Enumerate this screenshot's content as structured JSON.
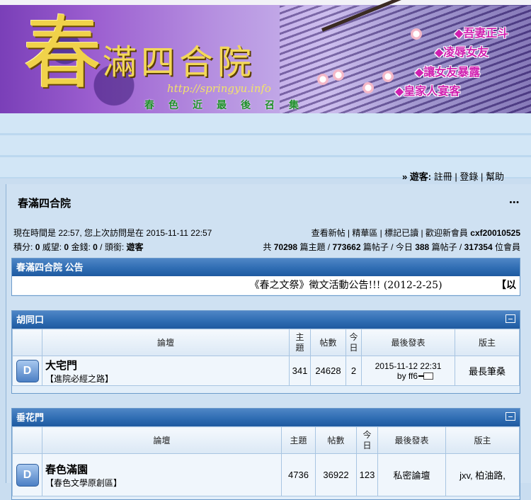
{
  "banner": {
    "title_first": "春",
    "title_rest": "滿四合院",
    "url": "http://springyu.info",
    "slogan": "春色近最後召集",
    "links": [
      "◆吾妻正斗",
      "◆凌辱女友",
      "◆讓女友暴露",
      "◆皇家人宴客"
    ]
  },
  "nav": {
    "guest_label": "» 遊客:",
    "register": "註冊",
    "login": "登錄",
    "help": "幫助"
  },
  "forum": {
    "title": "春滿四合院",
    "menu_dots": "•••"
  },
  "info": {
    "time_text": "現在時間是 22:57, 您上次訪問是在 2015-11-11 22:57",
    "links": "查看新帖 | 精華區 | 標記已讀 | 歡迎新會員",
    "new_member": "cxf20010525",
    "points_label": "積分:",
    "points": "0",
    "prestige_label": "威望:",
    "prestige": "0",
    "money_label": "金錢:",
    "money": "0",
    "rank_label": "/ 頭銜:",
    "rank": "遊客",
    "stats_prefix": "共",
    "threads": "70298",
    "threads_label": "篇主題 /",
    "posts": "773662",
    "posts_label": "篇帖子 / 今日",
    "today": "388",
    "today_label": "篇帖子 /",
    "members": "317354",
    "members_label": "位會員"
  },
  "announcement": {
    "header": "春滿四合院  公告",
    "text": "《春之文祭》徵文活動公告!!!",
    "date": "(2012-2-25)",
    "next": "【以"
  },
  "columns": {
    "forum": "論壇",
    "topics": "主題",
    "posts": "帖數",
    "today": "今日",
    "last": "最後發表",
    "mod": "版主"
  },
  "sections": [
    {
      "name": "胡同口",
      "forums": [
        {
          "icon": "D",
          "name": "大宅門",
          "desc": "【進院必經之路】",
          "topics": "341",
          "posts": "24628",
          "today": "2",
          "last_time": "2015-11-12 22:31",
          "last_by": "by ff6",
          "mod": "最長筆桑"
        }
      ]
    },
    {
      "name": "垂花門",
      "forums": [
        {
          "icon": "D",
          "name": "春色滿園",
          "desc": "【春色文學原創區】",
          "topics": "4736",
          "posts": "36922",
          "today": "123",
          "last_time": "私密論壇",
          "mod": "jxv, 柏油路,"
        }
      ]
    }
  ]
}
